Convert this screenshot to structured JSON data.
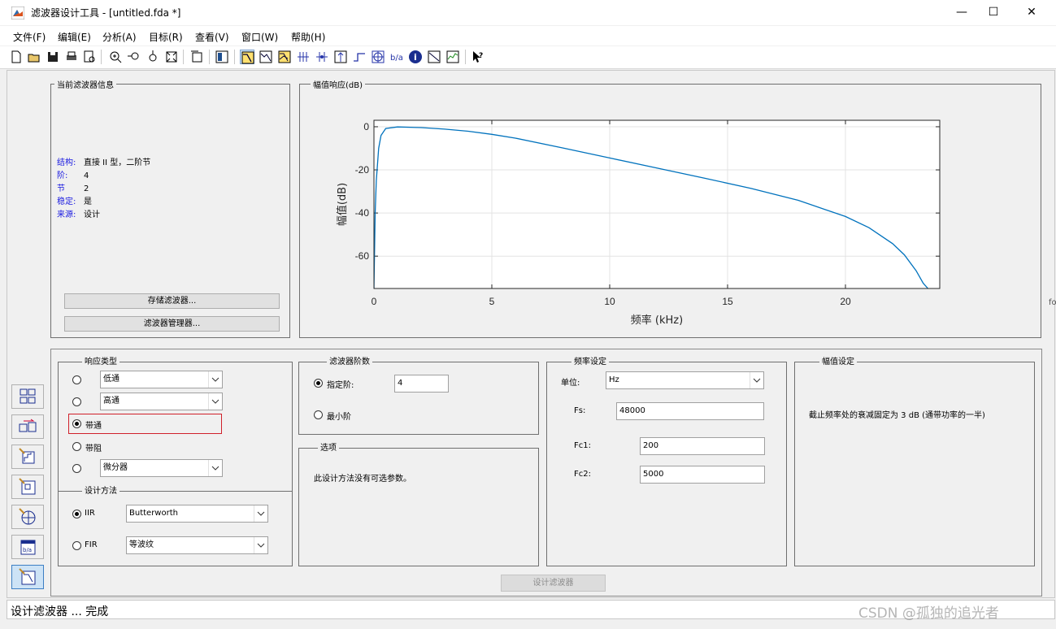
{
  "window": {
    "title": "滤波器设计工具 -  [untitled.fda *]",
    "minimize": "—",
    "maximize": "☐",
    "close": "✕"
  },
  "menu": [
    "文件(F)",
    "编辑(E)",
    "分析(A)",
    "目标(R)",
    "查看(V)",
    "窗口(W)",
    "帮助(H)"
  ],
  "current_filter": {
    "title": "当前滤波器信息",
    "rows": [
      {
        "key": "结构:",
        "value": "直接 II 型，二阶节"
      },
      {
        "key": "阶:",
        "value": "4"
      },
      {
        "key": "节",
        "value": "2"
      },
      {
        "key": "稳定:",
        "value": "是"
      },
      {
        "key": "来源:",
        "value": "设计"
      }
    ],
    "store_button": "存储滤波器...",
    "manager_button": "滤波器管理器..."
  },
  "magnitude_panel": {
    "title": "幅值响应(dB)"
  },
  "chart_data": {
    "type": "line",
    "title": "",
    "xlabel": "频率 (kHz)",
    "ylabel": "幅值(dB)",
    "xlim": [
      0,
      24
    ],
    "ylim": [
      -75,
      3
    ],
    "xticks": [
      0,
      5,
      10,
      15,
      20
    ],
    "yticks": [
      0,
      -20,
      -40,
      -60
    ],
    "grid": true,
    "color": "#0072bd",
    "x": [
      0,
      0.05,
      0.1,
      0.2,
      0.3,
      0.5,
      1,
      2,
      3,
      4,
      5,
      6,
      8,
      10,
      12,
      14,
      16,
      18,
      20,
      21,
      22,
      22.5,
      23,
      23.3,
      23.5
    ],
    "y": [
      -75,
      -40,
      -25,
      -10,
      -4,
      -0.8,
      -0.1,
      -0.4,
      -1.1,
      -2.1,
      -3.5,
      -5.3,
      -9.8,
      -14.5,
      -19.1,
      -23.8,
      -28.6,
      -34.1,
      -41.6,
      -46.8,
      -54.2,
      -59.4,
      -66.8,
      -72.6,
      -76
    ]
  },
  "response_type": {
    "title": "响应类型",
    "options": [
      {
        "label": "低通",
        "type": "select",
        "checked": false
      },
      {
        "label": "高通",
        "type": "select",
        "checked": false
      },
      {
        "label": "带通",
        "type": "plain",
        "checked": true
      },
      {
        "label": "带阻",
        "type": "plain",
        "checked": false
      },
      {
        "label": "微分器",
        "type": "select",
        "checked": false
      }
    ]
  },
  "design_method": {
    "title": "设计方法",
    "iir_label": "IIR",
    "iir_value": "Butterworth",
    "fir_label": "FIR",
    "fir_value": "等波纹"
  },
  "filter_order": {
    "title": "滤波器阶数",
    "specify_label": "指定阶:",
    "specify_value": "4",
    "minimum_label": "最小阶"
  },
  "options": {
    "title": "选项",
    "text": "此设计方法没有可选参数。"
  },
  "freq_spec": {
    "title": "频率设定",
    "units_label": "单位:",
    "units_value": "Hz",
    "fs_label": "Fs:",
    "fs_value": "48000",
    "fc1_label": "Fc1:",
    "fc1_value": "200",
    "fc2_label": "Fc2:",
    "fc2_value": "5000"
  },
  "mag_spec": {
    "title": "幅值设定",
    "text": "截止频率处的衰减固定为 3 dB (通带功率的一半)"
  },
  "design_button": "设计滤波器",
  "status": "设计滤波器 ... 完成",
  "watermark": "CSDN @孤独的追光者",
  "edge_text": "fo"
}
